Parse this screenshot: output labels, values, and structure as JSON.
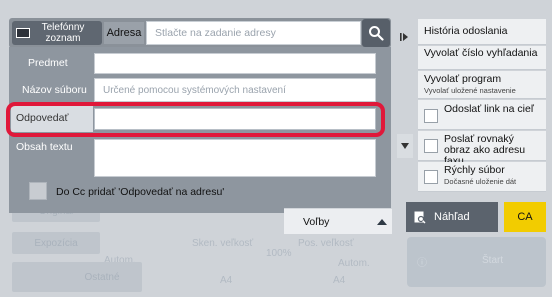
{
  "header": {
    "address_book_label": "Telefónny zoznam",
    "address_label": "Adresa",
    "address_placeholder": "Stlačte na zadanie adresy",
    "search_icon": "search-icon"
  },
  "form": {
    "subject_label": "Predmet",
    "subject_value": "",
    "filename_label": "Názov súboru",
    "filename_placeholder": "Určené pomocou systémových nastavení",
    "reply_to_label": "Odpovedať",
    "reply_to_value": "",
    "body_label": "Obsah textu",
    "body_value": "",
    "cc_checkbox_label": "Do Cc pridať 'Odpovedať na adresu'",
    "cc_checked": false,
    "options_label": "Voľby"
  },
  "right_panel": {
    "items": [
      {
        "label": "História odoslania",
        "sub": "",
        "checkbox": false
      },
      {
        "label": "Vyvolať číslo vyhľadania",
        "sub": "",
        "checkbox": false
      },
      {
        "label": "Vyvolať program",
        "sub": "Vyvolať uložené nastavenie",
        "checkbox": false
      },
      {
        "label": "Odoslať link na cieľ",
        "sub": "",
        "checkbox": true
      },
      {
        "label": "Poslať rovnaký obraz ako adresu faxu",
        "sub": "",
        "checkbox": true
      },
      {
        "label": "Rýchly súbor",
        "sub": "Dočasné uloženie dát",
        "checkbox": true
      }
    ],
    "preview_label": "Náhľad",
    "ca_label": "CA",
    "start_label": "Štart"
  },
  "background": {
    "original_label": "Originál",
    "exposure_label": "Expozícia",
    "auto_label_1": "Autom.",
    "other_label": "Ostatné",
    "scan_size_label": "Sken. veľkosť",
    "send_size_label": "Pos. veľkosť",
    "zoom_value": "100%",
    "size_value_1": "A4",
    "size_value_2": "A4",
    "auto_label_2": "Autom."
  },
  "colors": {
    "highlight": "#e0183a",
    "ca_button": "#f2cc00",
    "panel": "#8e969f"
  }
}
